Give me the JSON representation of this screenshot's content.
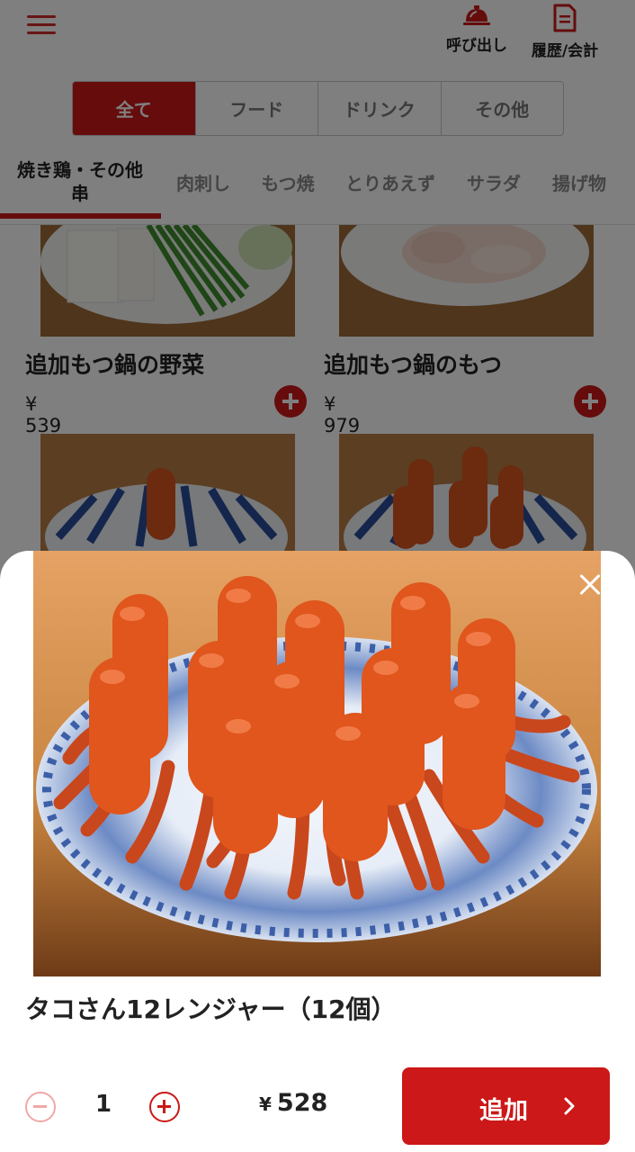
{
  "header": {
    "menu_icon": "hamburger-menu-icon",
    "call_label": "呼び出し",
    "call_icon": "service-bell-icon",
    "history_label": "履歴/会計",
    "history_icon": "receipt-icon"
  },
  "segments": [
    {
      "label": "全て",
      "active": true
    },
    {
      "label": "フード",
      "active": false
    },
    {
      "label": "ドリンク",
      "active": false
    },
    {
      "label": "その他",
      "active": false
    }
  ],
  "categories": [
    {
      "label": "焼き鶏・その他\n串",
      "active": true
    },
    {
      "label": "肉刺し"
    },
    {
      "label": "もつ焼"
    },
    {
      "label": "とりあえず"
    },
    {
      "label": "サラダ"
    },
    {
      "label": "揚げ物"
    }
  ],
  "menu_items": [
    {
      "name": "追加もつ鍋の野菜",
      "price": "¥ 539"
    },
    {
      "name": "追加もつ鍋のもつ",
      "price": "¥ 979"
    }
  ],
  "detail": {
    "title": "タコさん12レンジャー（12個）",
    "quantity": "1",
    "price_symbol": "¥",
    "price": "528",
    "add_label": "追加"
  },
  "colors": {
    "accent": "#cc1818",
    "accent_light": "#f0a8a8"
  }
}
